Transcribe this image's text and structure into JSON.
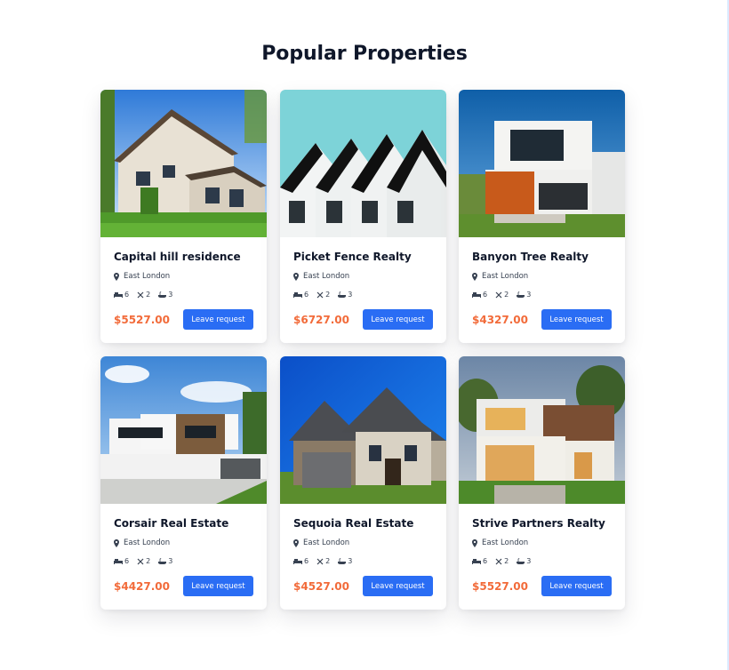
{
  "section": {
    "title": "Popular Properties"
  },
  "colors": {
    "accent": "#2a6df4",
    "price": "#f26b3a"
  },
  "properties": [
    {
      "name": "Capital hill residence",
      "location": "East London",
      "beds": "6",
      "kitchens": "2",
      "baths": "3",
      "price": "$5527.00",
      "button": "Leave request"
    },
    {
      "name": "Picket Fence Realty",
      "location": "East London",
      "beds": "6",
      "kitchens": "2",
      "baths": "3",
      "price": "$6727.00",
      "button": "Leave request"
    },
    {
      "name": "Banyon Tree Realty",
      "location": "East London",
      "beds": "6",
      "kitchens": "2",
      "baths": "3",
      "price": "$4327.00",
      "button": "Leave request"
    },
    {
      "name": "Corsair Real Estate",
      "location": "East London",
      "beds": "6",
      "kitchens": "2",
      "baths": "3",
      "price": "$4427.00",
      "button": "Leave request"
    },
    {
      "name": "Sequoia Real Estate",
      "location": "East London",
      "beds": "6",
      "kitchens": "2",
      "baths": "3",
      "price": "$4527.00",
      "button": "Leave request"
    },
    {
      "name": "Strive Partners Realty",
      "location": "East London",
      "beds": "6",
      "kitchens": "2",
      "baths": "3",
      "price": "$5527.00",
      "button": "Leave request"
    }
  ]
}
